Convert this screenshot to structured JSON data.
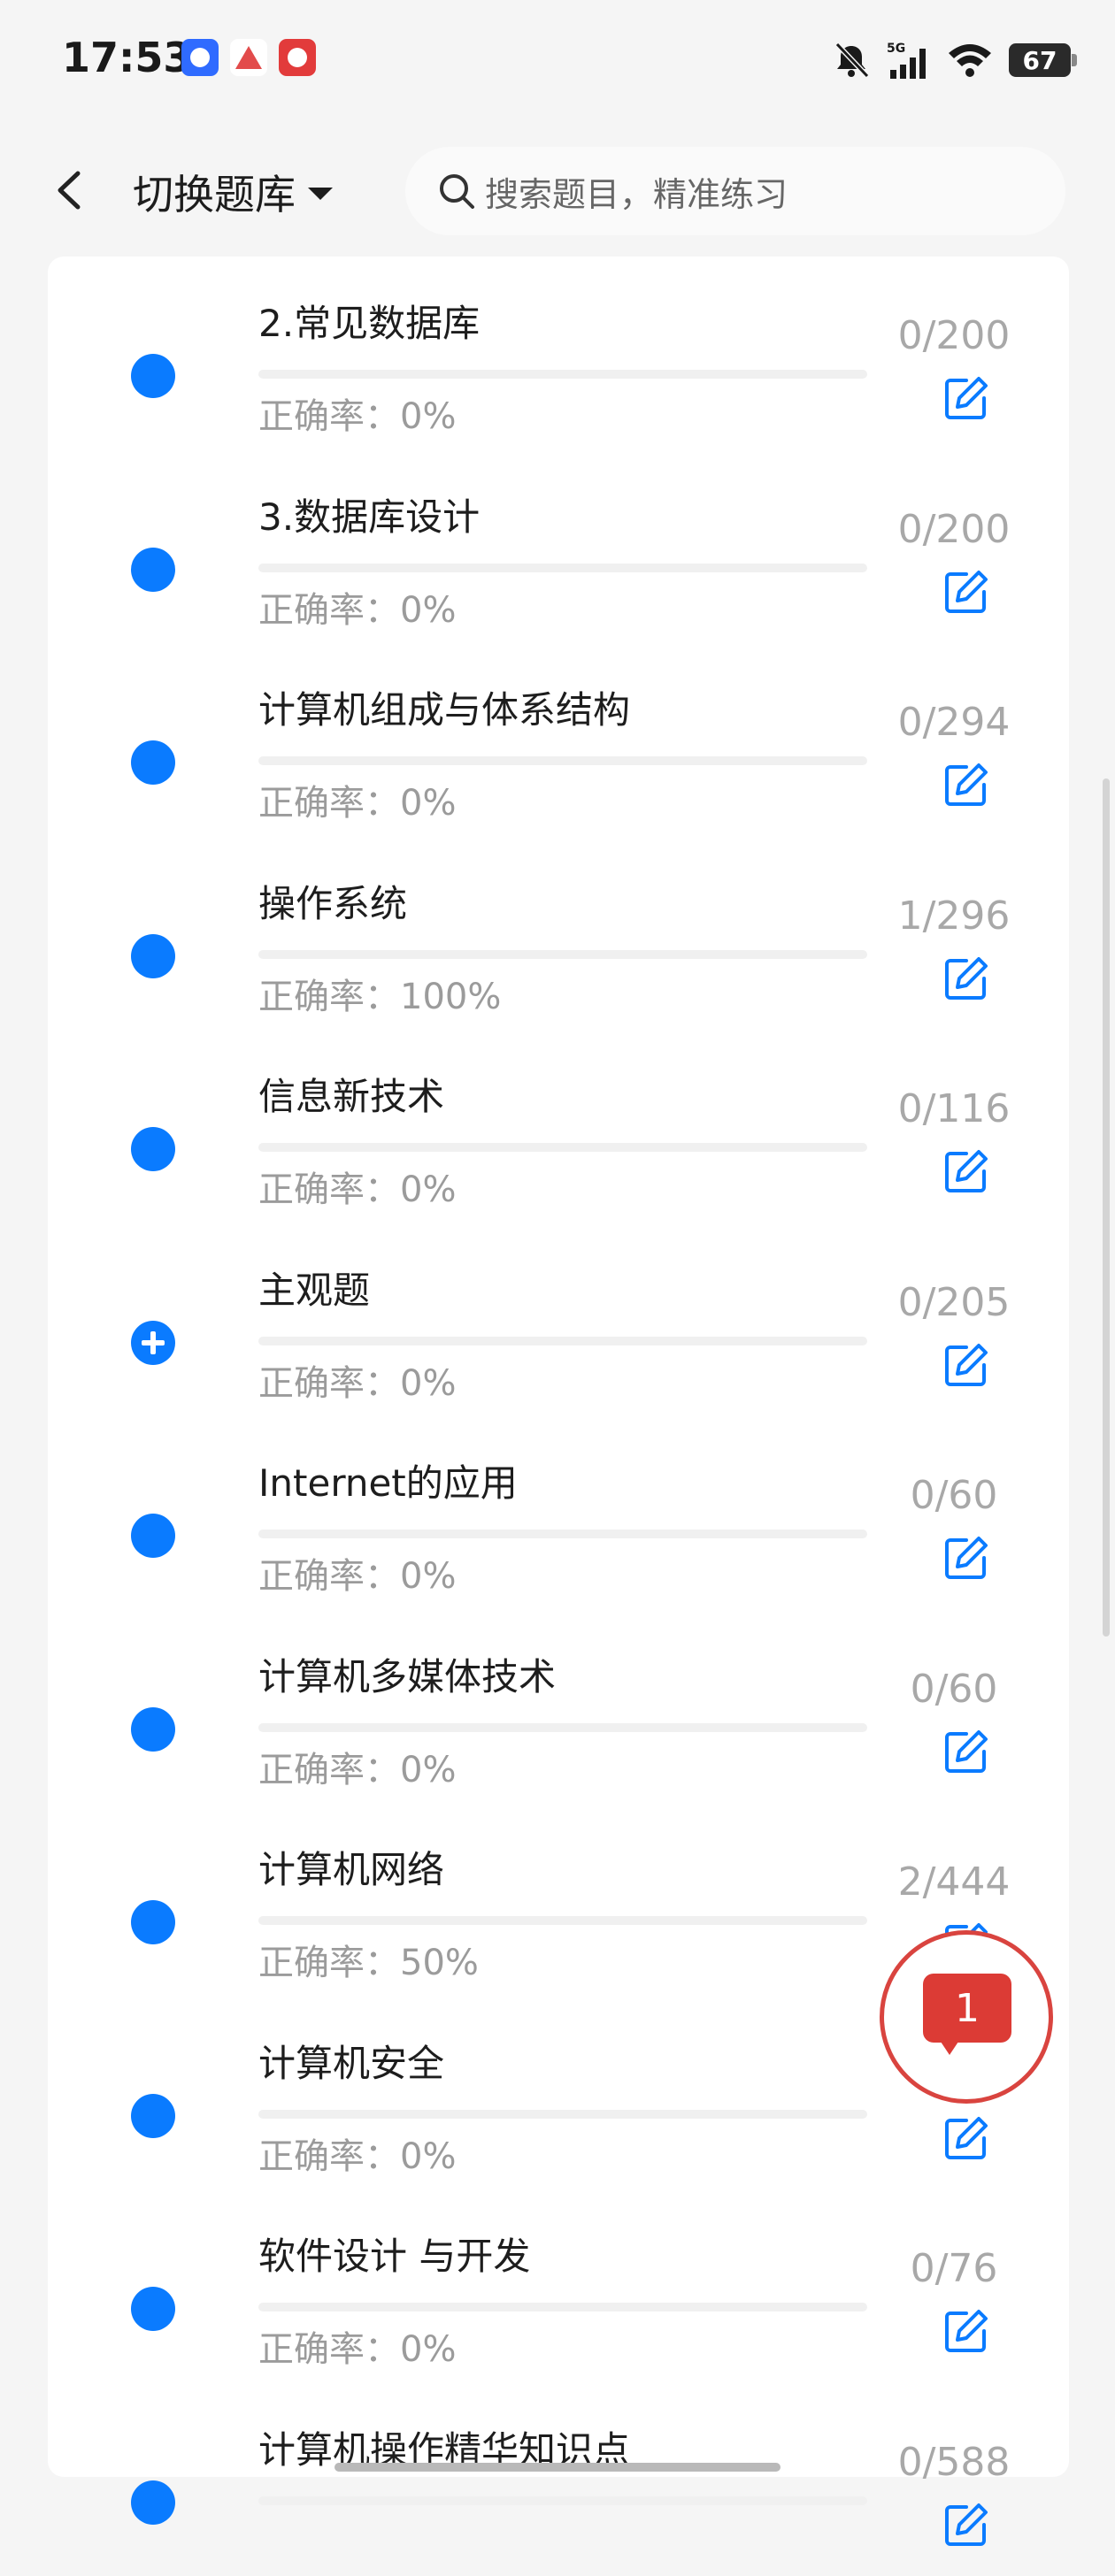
{
  "status_bar": {
    "time": "17:53",
    "battery": "67",
    "network": "5G",
    "icons": [
      "mute-bell-icon",
      "signal-icon",
      "wifi-icon",
      "battery-icon"
    ]
  },
  "header": {
    "title": "切换题库",
    "search_placeholder": "搜索题目，精准练习"
  },
  "colors": {
    "accent": "#0a7bff",
    "notification": "#dc3b35"
  },
  "items": [
    {
      "title": "2.常见数据库",
      "accuracy": "正确率：0%",
      "count": "0/200",
      "progress": 0,
      "icon": "dot"
    },
    {
      "title": "3.数据库设计",
      "accuracy": "正确率：0%",
      "count": "0/200",
      "progress": 0,
      "icon": "dot"
    },
    {
      "title": "计算机组成与体系结构",
      "accuracy": "正确率：0%",
      "count": "0/294",
      "progress": 0,
      "icon": "dot"
    },
    {
      "title": "操作系统",
      "accuracy": "正确率：100%",
      "count": "1/296",
      "progress": 0,
      "icon": "dot"
    },
    {
      "title": "信息新技术",
      "accuracy": "正确率：0%",
      "count": "0/116",
      "progress": 0,
      "icon": "dot"
    },
    {
      "title": "主观题",
      "accuracy": "正确率：0%",
      "count": "0/205",
      "progress": 0,
      "icon": "plus"
    },
    {
      "title": "Internet的应用",
      "accuracy": "正确率：0%",
      "count": "0/60",
      "progress": 0,
      "icon": "dot"
    },
    {
      "title": "计算机多媒体技术",
      "accuracy": "正确率：0%",
      "count": "0/60",
      "progress": 0,
      "icon": "dot"
    },
    {
      "title": "计算机网络",
      "accuracy": "正确率：50%",
      "count": "2/444",
      "progress": 0,
      "icon": "dot"
    },
    {
      "title": "计算机安全",
      "accuracy": "正确率：0%",
      "count": "",
      "progress": 0,
      "icon": "dot"
    },
    {
      "title": "软件设计 与开发",
      "accuracy": "正确率：0%",
      "count": "0/76",
      "progress": 0,
      "icon": "dot"
    },
    {
      "title": "计算机操作精华知识点",
      "accuracy": "",
      "count": "0/588",
      "progress": 0,
      "icon": "dot"
    }
  ],
  "fab": {
    "badge": "1"
  }
}
